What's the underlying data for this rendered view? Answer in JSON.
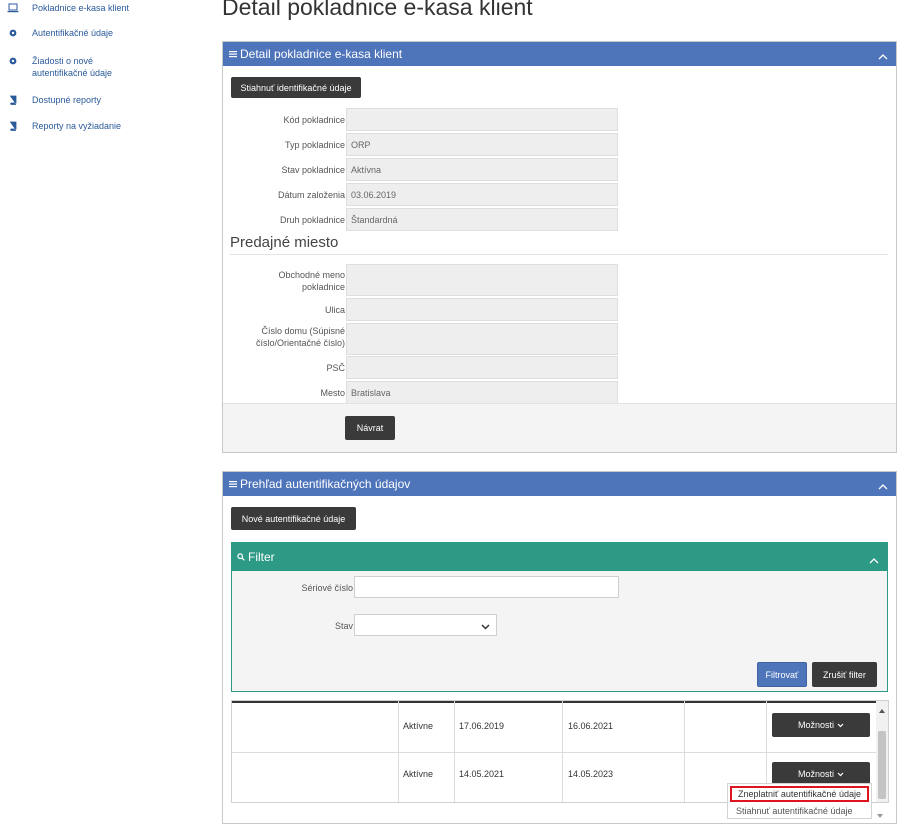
{
  "sidebar": {
    "items": [
      {
        "label": "Pokladnice e-kasa klient",
        "icon": "laptop-icon"
      },
      {
        "label": "Autentifikačné údaje",
        "icon": "gear-icon"
      },
      {
        "label": "Žiadosti o nové autentifikačné údaje",
        "icon": "gear-icon"
      },
      {
        "label": "Dostupné reporty",
        "icon": "book-icon"
      },
      {
        "label": "Reporty na vyžiadanie",
        "icon": "book-icon"
      }
    ]
  },
  "page": {
    "title": "Detail pokladnice e-kasa klient"
  },
  "detail_panel": {
    "header": "Detail pokladnice e-kasa klient",
    "download_button": "Stiahnuť identifikačné údaje",
    "fields": [
      {
        "label": "Kód pokladnice",
        "value": ""
      },
      {
        "label": "Typ pokladnice",
        "value": "ORP"
      },
      {
        "label": "Stav pokladnice",
        "value": "Aktívna"
      },
      {
        "label": "Dátum založenia",
        "value": "03.06.2019"
      },
      {
        "label": "Druh pokladnice",
        "value": "Štandardná"
      }
    ],
    "section_title": "Predajné miesto",
    "place_fields": [
      {
        "label": "Obchodné meno pokladnice",
        "value": ""
      },
      {
        "label": "Ulica",
        "value": ""
      },
      {
        "label": "Číslo domu (Súpisné číslo/Orientačné číslo)",
        "value": ""
      },
      {
        "label": "PSČ",
        "value": ""
      },
      {
        "label": "Mesto",
        "value": "Bratislava"
      }
    ],
    "back_button": "Návrat"
  },
  "auth_panel": {
    "header": "Prehľad autentifikačných údajov",
    "new_button": "Nové autentifikačné údaje",
    "filter": {
      "header": "Filter",
      "serial_label": "Sériové číslo",
      "serial_value": "",
      "status_label": "Stav",
      "status_value": "",
      "apply_button": "Filtrovať",
      "clear_button": "Zrušiť filter"
    },
    "rows": [
      {
        "status": "Aktívne",
        "valid_from": "17.06.2019",
        "valid_to": "16.06.2021",
        "options": "Možnosti"
      },
      {
        "status": "Aktívne",
        "valid_from": "14.05.2021",
        "valid_to": "14.05.2023",
        "options": "Možnosti"
      }
    ],
    "dropdown": {
      "items": [
        "Zneplatniť autentifikačné údaje",
        "Stiahnuť autentifikačné údaje"
      ]
    }
  },
  "colors": {
    "panel_header": "#4e74ba",
    "filter_header": "#2d9a85",
    "dark_button": "#3a3a3a",
    "highlight": "#e0141e"
  }
}
